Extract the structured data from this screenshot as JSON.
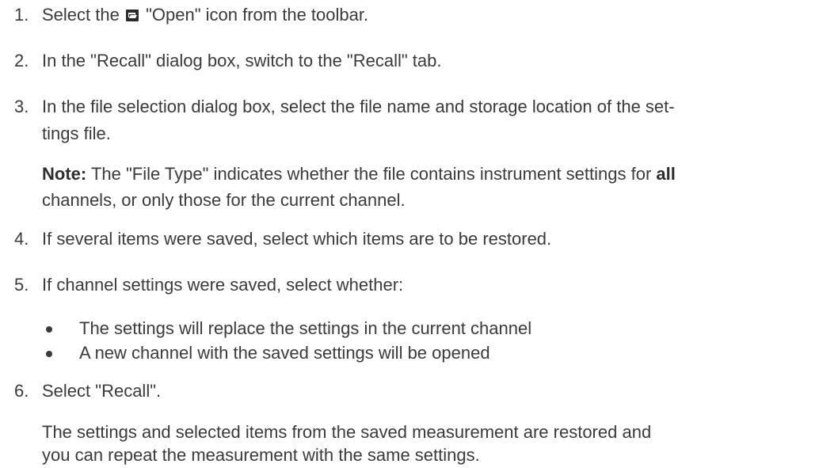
{
  "steps": [
    {
      "number": "1.",
      "text_before_icon": "Select the",
      "icon": "open-folder-icon",
      "text_after_icon": "\"Open\" icon from the toolbar."
    },
    {
      "number": "2.",
      "text": "In the \"Recall\" dialog box, switch to the \"Recall\" tab."
    },
    {
      "number": "3.",
      "text_line1": "In the file selection dialog box, select the file name and storage location of the set-",
      "text_line2": "tings file.",
      "note": {
        "label": "Note:",
        "text_line1_part1": "The \"File Type\" indicates whether the file contains instrument settings for",
        "text_line1_bold": "all",
        "text_line2": "channels, or only those for the current channel."
      }
    },
    {
      "number": "4.",
      "text": "If several items were saved, select which items are to be restored."
    },
    {
      "number": "5.",
      "text": "If channel settings were saved, select whether:",
      "bullets": [
        "The settings will replace the settings in the current channel",
        "A new channel with the saved settings will be opened"
      ]
    },
    {
      "number": "6.",
      "text": "Select \"Recall\".",
      "result_line1": "The settings and selected items from the saved measurement are restored and",
      "result_line2": "you can repeat the measurement with the same settings."
    }
  ]
}
